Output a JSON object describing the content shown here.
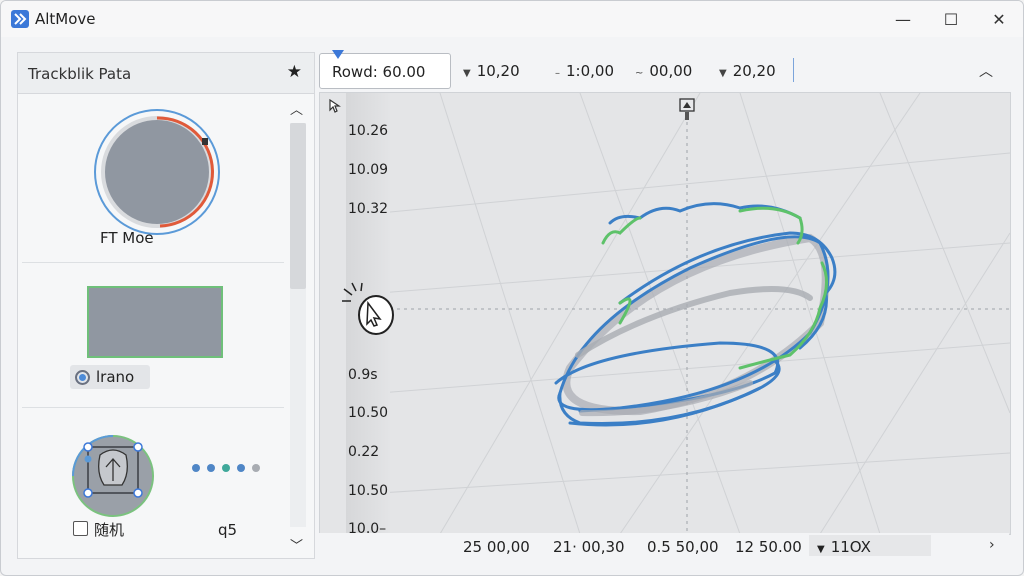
{
  "window": {
    "title": "AltMove",
    "minimize": "—",
    "maximize": "☐",
    "close": "✕"
  },
  "left_panel": {
    "title": "Trackblik Pata",
    "star": "★",
    "dial_label": "FT Moe",
    "chip_label": "lrano",
    "checkbox_label": "随机",
    "q_label": "q5",
    "dot_colors": [
      "#4f86c6",
      "#4f86c6",
      "#3fa89a",
      "#4f86c6",
      "#a8acb2"
    ]
  },
  "toolbar": {
    "input_value": "Rowd: 60.00",
    "items": [
      "10,20",
      "1:0,00",
      "00,00",
      "20,20"
    ]
  },
  "viewport": {
    "y_ticks": [
      "10.26",
      "10.09",
      "10.32",
      "0.9s",
      "10.50",
      "0.22",
      "10.50",
      "10.0–"
    ],
    "bottom_items": [
      "25  00,00",
      "21·  00,30",
      "0.5  50,00",
      "12  50.00",
      "11OX"
    ],
    "colors": {
      "trail_blue": "#3b7fc6",
      "trail_green": "#5ec26a",
      "trail_gray": "#a9adb3"
    }
  }
}
